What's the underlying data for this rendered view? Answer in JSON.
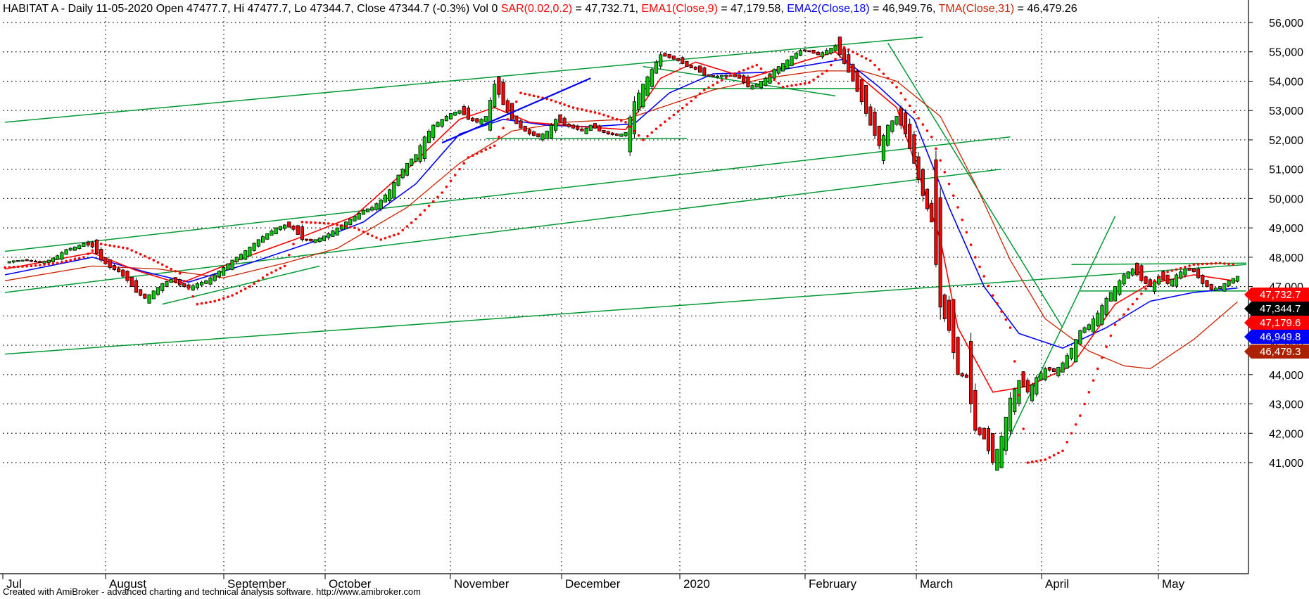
{
  "header": {
    "symbol_line": "HABITAT A - Daily 11-05-2020 Open 47477.7, Hi 47477.7, Lo 47344.7, Close 47344.7 (-0.3%) Vol 0",
    "sar_label": "SAR(0.02,0.2)",
    "sar_value": " = 47,732.71,",
    "ema1_label": "EMA1(Close,9)",
    "ema1_value": " = 47,179.58,",
    "ema2_label": "EMA2(Close,18)",
    "ema2_value": " = 46,949.76,",
    "tma_label": "TMA(Close,31)",
    "tma_value": " = 46,479.26"
  },
  "footer": "Created with AmiBroker - advanced charting and technical analysis software. http://www.amibroker.com",
  "colors": {
    "up": "#00cc00",
    "down": "#ff0000",
    "sar": "#ff0000",
    "ema1": "#ff0000",
    "ema2": "#0000ff",
    "tma": "#cc2200",
    "trendlines": "#009933",
    "user_line": "#0000ff",
    "grid": "#000000"
  },
  "chart_data": {
    "type": "candlestick",
    "title": "HABITAT A - Daily",
    "y_ticks": [
      "41,000",
      "42,000",
      "43,000",
      "44,000",
      "45,000",
      "46,000",
      "47,000",
      "48,000",
      "49,000",
      "50,000",
      "51,000",
      "52,000",
      "53,000",
      "54,000",
      "55,000",
      "56,000"
    ],
    "ylim": [
      40700,
      56300
    ],
    "x_labels": [
      "Jul",
      "August",
      "September",
      "October",
      "November",
      "December",
      "2020",
      "February",
      "March",
      "April",
      "May"
    ],
    "value_tags": [
      {
        "label": "47,732.7",
        "value": 47732.7,
        "color": "#ff0000"
      },
      {
        "label": "47,344.7",
        "value": 47344.7,
        "color": "#000000"
      },
      {
        "label": "47,179.6",
        "value": 47179.6,
        "color": "#ff0000"
      },
      {
        "label": "46,949.8",
        "value": 46949.8,
        "color": "#0000ff"
      },
      {
        "label": "46,479.3",
        "value": 46479.3,
        "color": "#aa2200"
      }
    ],
    "close_path": [
      [
        0,
        47830
      ],
      [
        2,
        47880
      ],
      [
        4,
        47900
      ],
      [
        6,
        47860
      ],
      [
        8,
        47820
      ],
      [
        10,
        47900
      ],
      [
        12,
        48050
      ],
      [
        14,
        48260
      ],
      [
        16,
        48350
      ],
      [
        18,
        48470
      ],
      [
        20,
        48350
      ],
      [
        22,
        47900
      ],
      [
        24,
        47650
      ],
      [
        26,
        47500
      ],
      [
        28,
        47200
      ],
      [
        30,
        46800
      ],
      [
        32,
        46600
      ],
      [
        34,
        46850
      ],
      [
        36,
        47100
      ],
      [
        38,
        47250
      ],
      [
        40,
        47050
      ],
      [
        42,
        46950
      ],
      [
        44,
        47100
      ],
      [
        46,
        47200
      ],
      [
        48,
        47400
      ],
      [
        50,
        47650
      ],
      [
        52,
        47900
      ],
      [
        54,
        48100
      ],
      [
        56,
        48350
      ],
      [
        58,
        48600
      ],
      [
        60,
        48800
      ],
      [
        62,
        49000
      ],
      [
        64,
        49100
      ],
      [
        66,
        48950
      ],
      [
        68,
        48600
      ],
      [
        70,
        48550
      ],
      [
        72,
        48650
      ],
      [
        74,
        48800
      ],
      [
        76,
        49000
      ],
      [
        78,
        49200
      ],
      [
        80,
        49400
      ],
      [
        82,
        49600
      ],
      [
        84,
        49700
      ],
      [
        86,
        49950
      ],
      [
        88,
        50300
      ],
      [
        90,
        50800
      ],
      [
        92,
        51200
      ],
      [
        94,
        51500
      ],
      [
        96,
        52100
      ],
      [
        98,
        52500
      ],
      [
        100,
        52700
      ],
      [
        102,
        52900
      ],
      [
        104,
        53000
      ],
      [
        106,
        52700
      ],
      [
        108,
        52600
      ],
      [
        110,
        52800
      ],
      [
        112,
        53900
      ],
      [
        114,
        53200
      ],
      [
        116,
        52700
      ],
      [
        118,
        52400
      ],
      [
        120,
        52200
      ],
      [
        122,
        52100
      ],
      [
        124,
        52300
      ],
      [
        126,
        52700
      ],
      [
        128,
        52500
      ],
      [
        130,
        52400
      ],
      [
        132,
        52300
      ],
      [
        134,
        52500
      ],
      [
        136,
        52300
      ],
      [
        138,
        52200
      ],
      [
        140,
        52150
      ],
      [
        142,
        52250
      ],
      [
        144,
        53300
      ],
      [
        146,
        53900
      ],
      [
        148,
        54400
      ],
      [
        150,
        54900
      ],
      [
        152,
        54800
      ],
      [
        154,
        54700
      ],
      [
        156,
        54500
      ],
      [
        158,
        54400
      ],
      [
        160,
        54200
      ],
      [
        162,
        54150
      ],
      [
        164,
        54200
      ],
      [
        166,
        54200
      ],
      [
        168,
        54100
      ],
      [
        170,
        53800
      ],
      [
        172,
        53900
      ],
      [
        174,
        54100
      ],
      [
        176,
        54400
      ],
      [
        178,
        54600
      ],
      [
        180,
        54850
      ],
      [
        182,
        55050
      ],
      [
        184,
        55000
      ],
      [
        186,
        54900
      ],
      [
        188,
        55050
      ],
      [
        190,
        55200
      ],
      [
        192,
        54600
      ],
      [
        194,
        54000
      ],
      [
        196,
        53300
      ],
      [
        198,
        52500
      ],
      [
        200,
        51800
      ],
      [
        202,
        52500
      ],
      [
        204,
        52800
      ],
      [
        206,
        52200
      ],
      [
        208,
        51200
      ],
      [
        210,
        50100
      ],
      [
        212,
        49200
      ],
      [
        214,
        46300
      ],
      [
        216,
        45500
      ],
      [
        218,
        44000
      ],
      [
        220,
        43900
      ],
      [
        222,
        42100
      ],
      [
        224,
        41800
      ],
      [
        226,
        41000
      ],
      [
        228,
        41900
      ],
      [
        230,
        43200
      ],
      [
        232,
        43800
      ],
      [
        234,
        43400
      ],
      [
        236,
        43900
      ],
      [
        238,
        44200
      ],
      [
        240,
        44100
      ],
      [
        242,
        44400
      ],
      [
        244,
        44900
      ],
      [
        246,
        45500
      ],
      [
        248,
        45700
      ],
      [
        250,
        46100
      ],
      [
        252,
        46600
      ],
      [
        254,
        47000
      ],
      [
        256,
        47400
      ],
      [
        258,
        47600
      ],
      [
        260,
        47200
      ],
      [
        262,
        47000
      ],
      [
        264,
        47350
      ],
      [
        266,
        47100
      ],
      [
        268,
        47400
      ],
      [
        270,
        47600
      ],
      [
        272,
        47500
      ],
      [
        274,
        47100
      ],
      [
        276,
        46900
      ],
      [
        278,
        47000
      ],
      [
        280,
        47200
      ],
      [
        282,
        47350
      ]
    ],
    "ema1": [
      [
        0,
        47600
      ],
      [
        20,
        48150
      ],
      [
        30,
        47550
      ],
      [
        40,
        47100
      ],
      [
        55,
        48000
      ],
      [
        68,
        48700
      ],
      [
        80,
        49400
      ],
      [
        92,
        51000
      ],
      [
        104,
        52700
      ],
      [
        112,
        53100
      ],
      [
        120,
        52600
      ],
      [
        132,
        52450
      ],
      [
        142,
        52350
      ],
      [
        150,
        54100
      ],
      [
        158,
        54650
      ],
      [
        170,
        54100
      ],
      [
        182,
        54650
      ],
      [
        190,
        55000
      ],
      [
        196,
        54100
      ],
      [
        204,
        53100
      ],
      [
        214,
        48600
      ],
      [
        218,
        45600
      ],
      [
        226,
        43400
      ],
      [
        234,
        43600
      ],
      [
        244,
        44300
      ],
      [
        254,
        46400
      ],
      [
        262,
        47100
      ],
      [
        272,
        47400
      ],
      [
        282,
        47180
      ]
    ],
    "ema2": [
      [
        0,
        47400
      ],
      [
        20,
        48000
      ],
      [
        32,
        47500
      ],
      [
        42,
        47150
      ],
      [
        56,
        47800
      ],
      [
        70,
        48500
      ],
      [
        82,
        49200
      ],
      [
        94,
        50500
      ],
      [
        104,
        52200
      ],
      [
        114,
        52700
      ],
      [
        124,
        52500
      ],
      [
        134,
        52450
      ],
      [
        144,
        52550
      ],
      [
        152,
        53600
      ],
      [
        162,
        54250
      ],
      [
        174,
        54300
      ],
      [
        186,
        54600
      ],
      [
        192,
        54750
      ],
      [
        200,
        53800
      ],
      [
        208,
        52700
      ],
      [
        216,
        49700
      ],
      [
        224,
        47000
      ],
      [
        232,
        45400
      ],
      [
        242,
        44900
      ],
      [
        252,
        45600
      ],
      [
        262,
        46500
      ],
      [
        272,
        46800
      ],
      [
        282,
        46950
      ]
    ],
    "tma": [
      [
        0,
        47200
      ],
      [
        20,
        47700
      ],
      [
        35,
        47600
      ],
      [
        50,
        47300
      ],
      [
        64,
        47800
      ],
      [
        76,
        48300
      ],
      [
        92,
        49700
      ],
      [
        104,
        51200
      ],
      [
        116,
        52300
      ],
      [
        128,
        52600
      ],
      [
        142,
        52700
      ],
      [
        150,
        53100
      ],
      [
        162,
        53700
      ],
      [
        174,
        54100
      ],
      [
        186,
        54350
      ],
      [
        196,
        54350
      ],
      [
        204,
        54000
      ],
      [
        214,
        52800
      ],
      [
        222,
        50500
      ],
      [
        230,
        47900
      ],
      [
        238,
        45900
      ],
      [
        248,
        44800
      ],
      [
        256,
        44300
      ],
      [
        262,
        44200
      ],
      [
        272,
        45200
      ],
      [
        282,
        46480
      ]
    ],
    "sar": [
      [
        0,
        47650
      ],
      [
        6,
        47700
      ],
      [
        12,
        47800
      ],
      [
        18,
        48000
      ],
      [
        22,
        48450
      ],
      [
        28,
        48300
      ],
      [
        34,
        47900
      ],
      [
        40,
        47450
      ],
      [
        44,
        46400
      ],
      [
        48,
        46500
      ],
      [
        52,
        46700
      ],
      [
        56,
        47000
      ],
      [
        60,
        47400
      ],
      [
        64,
        47700
      ],
      [
        68,
        49200
      ],
      [
        74,
        49150
      ],
      [
        80,
        49000
      ],
      [
        86,
        48600
      ],
      [
        90,
        48800
      ],
      [
        94,
        49300
      ],
      [
        100,
        50200
      ],
      [
        106,
        51400
      ],
      [
        112,
        51800
      ],
      [
        118,
        53600
      ],
      [
        124,
        53400
      ],
      [
        130,
        53100
      ],
      [
        136,
        52900
      ],
      [
        142,
        52600
      ],
      [
        146,
        52000
      ],
      [
        150,
        52500
      ],
      [
        156,
        53200
      ],
      [
        160,
        53700
      ],
      [
        166,
        54200
      ],
      [
        172,
        54550
      ],
      [
        178,
        53800
      ],
      [
        184,
        53950
      ],
      [
        188,
        54350
      ],
      [
        192,
        55150
      ],
      [
        198,
        54700
      ],
      [
        204,
        53800
      ],
      [
        212,
        52100
      ],
      [
        218,
        49700
      ],
      [
        222,
        48000
      ],
      [
        226,
        46700
      ],
      [
        230,
        45600
      ],
      [
        234,
        41000
      ],
      [
        238,
        41100
      ],
      [
        242,
        41400
      ],
      [
        246,
        42600
      ],
      [
        250,
        44200
      ],
      [
        254,
        45700
      ],
      [
        258,
        46400
      ],
      [
        262,
        47100
      ],
      [
        266,
        47500
      ],
      [
        272,
        47750
      ],
      [
        278,
        47800
      ],
      [
        282,
        47733
      ]
    ],
    "trendlines": [
      {
        "from": [
          0,
          52600
        ],
        "to": [
          210,
          55500
        ]
      },
      {
        "from": [
          0,
          48200
        ],
        "to": [
          230,
          52100
        ]
      },
      {
        "from": [
          0,
          46800
        ],
        "to": [
          228,
          51000
        ]
      },
      {
        "from": [
          0,
          44700
        ],
        "to": [
          284,
          47750
        ]
      },
      {
        "from": [
          146,
          53750
        ],
        "to": [
          196,
          53750
        ]
      },
      {
        "from": [
          110,
          52050
        ],
        "to": [
          156,
          52050
        ]
      },
      {
        "from": [
          244,
          47750
        ],
        "to": [
          284,
          47800
        ]
      },
      {
        "from": [
          246,
          46850
        ],
        "to": [
          284,
          46850
        ]
      },
      {
        "from": [
          146,
          54500
        ],
        "to": [
          190,
          53500
        ]
      },
      {
        "from": [
          202,
          55300
        ],
        "to": [
          242,
          45600
        ]
      },
      {
        "from": [
          228,
          41300
        ],
        "to": [
          254,
          49400
        ]
      },
      {
        "from": [
          36,
          46400
        ],
        "to": [
          72,
          47700
        ]
      }
    ],
    "user_line": {
      "from": [
        100,
        51900
      ],
      "to": [
        134,
        54100
      ]
    }
  }
}
